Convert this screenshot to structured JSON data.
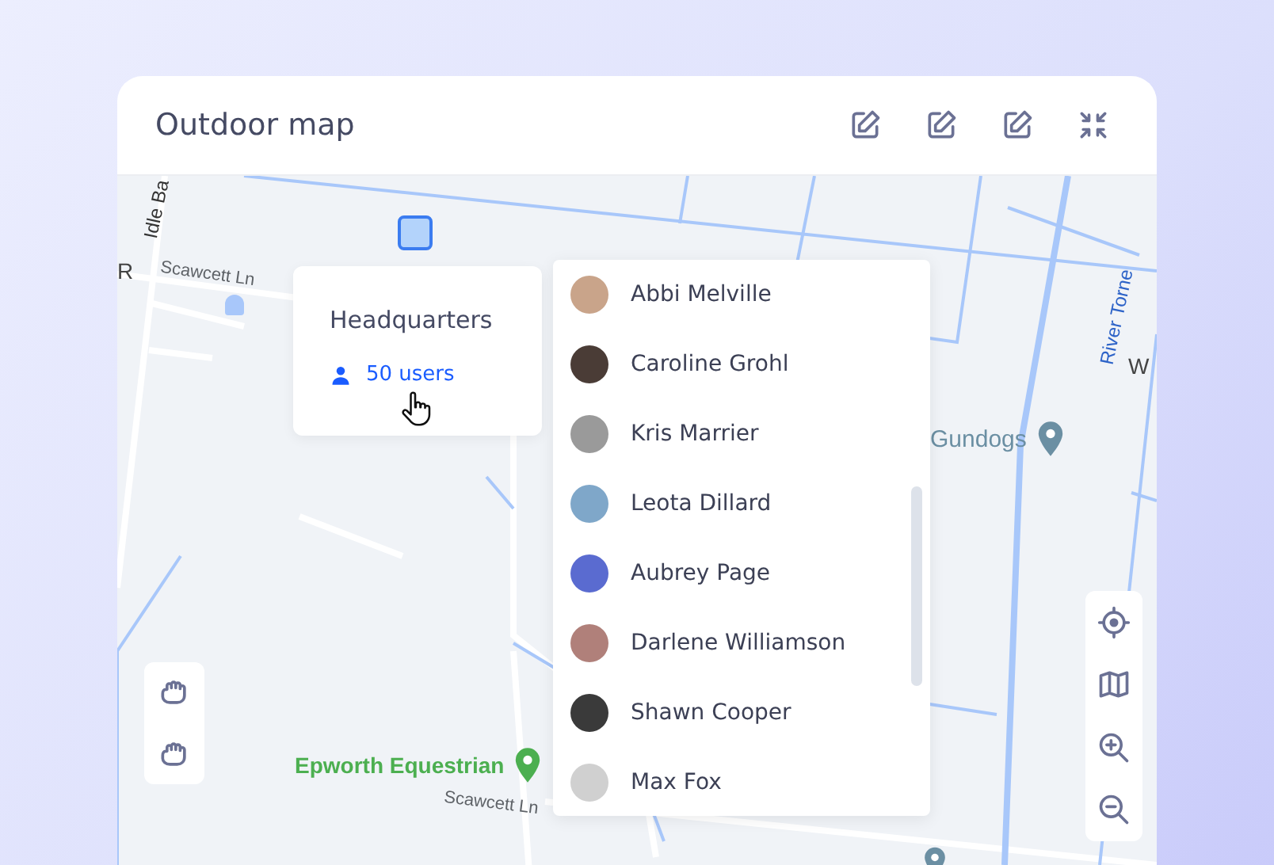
{
  "window": {
    "title": "Outdoor map"
  },
  "map": {
    "labels": [
      {
        "text": "Idle Ba",
        "kind": "road"
      },
      {
        "text": "R",
        "kind": "road"
      },
      {
        "text": "Scawcett Ln",
        "kind": "road"
      },
      {
        "text": "Scawcett Ln",
        "kind": "road"
      },
      {
        "text": "River Torne",
        "kind": "water"
      },
      {
        "text": "W",
        "kind": "road"
      }
    ],
    "places": [
      {
        "name": "Epworth Equestrian",
        "color": "#4caf50"
      },
      {
        "name": "Gundogs",
        "color": "#6b8fa3"
      }
    ]
  },
  "popup": {
    "title": "Headquarters",
    "link": "50 users"
  },
  "users": [
    "Abbi Melville",
    "Caroline Grohl",
    "Kris Marrier",
    "Leota Dillard",
    "Aubrey Page",
    "Darlene Williamson",
    "Shawn Cooper",
    "Max Fox"
  ]
}
